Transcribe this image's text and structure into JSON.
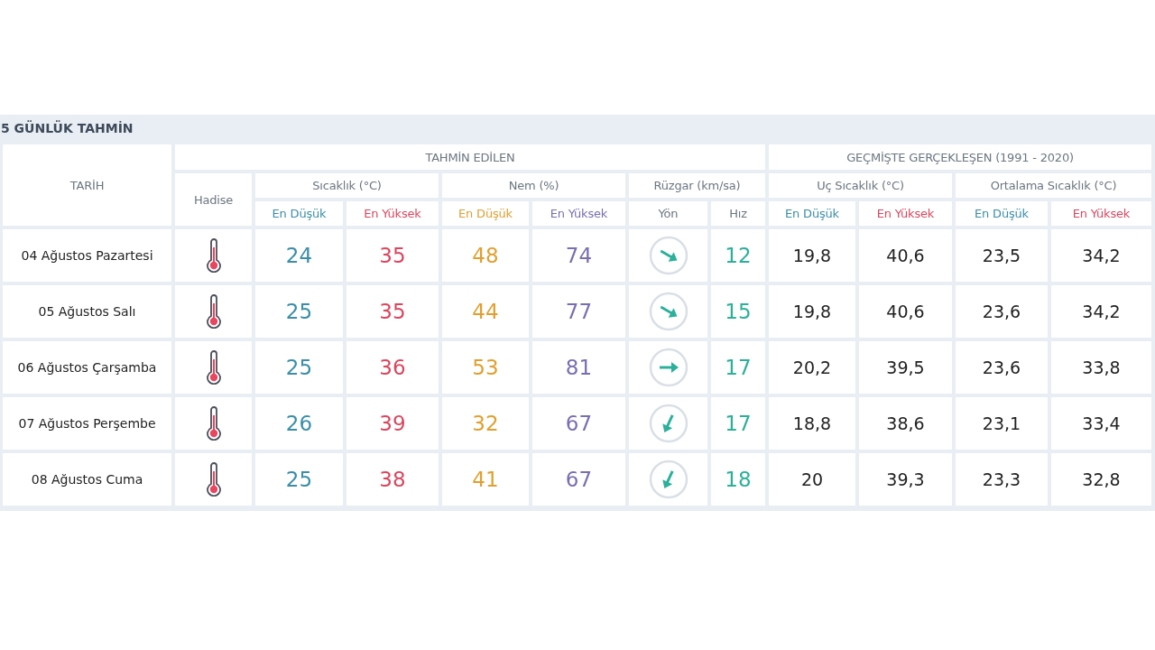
{
  "title": "5 GÜNLÜK TAHMİN",
  "header": {
    "date": "TARİH",
    "forecast": "TAHMİN EDİLEN",
    "history": "GEÇMİŞTE GERÇEKLEŞEN (1991 - 2020)",
    "event": "Hadise",
    "forecast_groups": [
      {
        "label": "Sıcaklık (°C)",
        "subs": [
          {
            "label": "En Düşük",
            "color": "#3a8ea8"
          },
          {
            "label": "En Yüksek",
            "color": "#d9475f"
          }
        ]
      },
      {
        "label": "Nem (%)",
        "subs": [
          {
            "label": "En Düşük",
            "color": "#e0a030"
          },
          {
            "label": "En Yüksek",
            "color": "#7a6eb0"
          }
        ]
      },
      {
        "label": "Rüzgar (km/sa)",
        "subs": [
          {
            "label": "Yön",
            "color": "#6b7780"
          },
          {
            "label": "Hız",
            "color": "#6b7780"
          }
        ]
      }
    ],
    "history_groups": [
      {
        "label": "Uç Sıcaklık (°C)",
        "subs": [
          {
            "label": "En Düşük",
            "color": "#3a8ea8"
          },
          {
            "label": "En Yüksek",
            "color": "#d9475f"
          }
        ]
      },
      {
        "label": "Ortalama Sıcaklık (°C)",
        "subs": [
          {
            "label": "En Düşük",
            "color": "#3a8ea8"
          },
          {
            "label": "En Yüksek",
            "color": "#d9475f"
          }
        ]
      }
    ]
  },
  "rows": [
    {
      "date": "04 Ağustos Pazartesi",
      "forecast": [
        "24",
        "35",
        "48",
        "74"
      ],
      "wind": {
        "kind": "ese",
        "speed": "12"
      },
      "history": [
        "19,8",
        "40,6",
        "23,5",
        "34,2"
      ]
    },
    {
      "date": "05 Ağustos Salı",
      "forecast": [
        "25",
        "35",
        "44",
        "77"
      ],
      "wind": {
        "kind": "ese",
        "speed": "15"
      },
      "history": [
        "19,8",
        "40,6",
        "23,6",
        "34,2"
      ]
    },
    {
      "date": "06 Ağustos Çarşamba",
      "forecast": [
        "25",
        "36",
        "53",
        "81"
      ],
      "wind": {
        "kind": "e",
        "speed": "17"
      },
      "history": [
        "20,2",
        "39,5",
        "23,6",
        "33,8"
      ]
    },
    {
      "date": "07 Ağustos Perşembe",
      "forecast": [
        "26",
        "39",
        "32",
        "67"
      ],
      "wind": {
        "kind": "ssw",
        "speed": "17"
      },
      "history": [
        "18,8",
        "38,6",
        "23,1",
        "33,4"
      ]
    },
    {
      "date": "08 Ağustos Cuma",
      "forecast": [
        "25",
        "38",
        "41",
        "67"
      ],
      "wind": {
        "kind": "ssw",
        "speed": "18"
      },
      "history": [
        "20",
        "39,3",
        "23,3",
        "32,8"
      ]
    }
  ]
}
